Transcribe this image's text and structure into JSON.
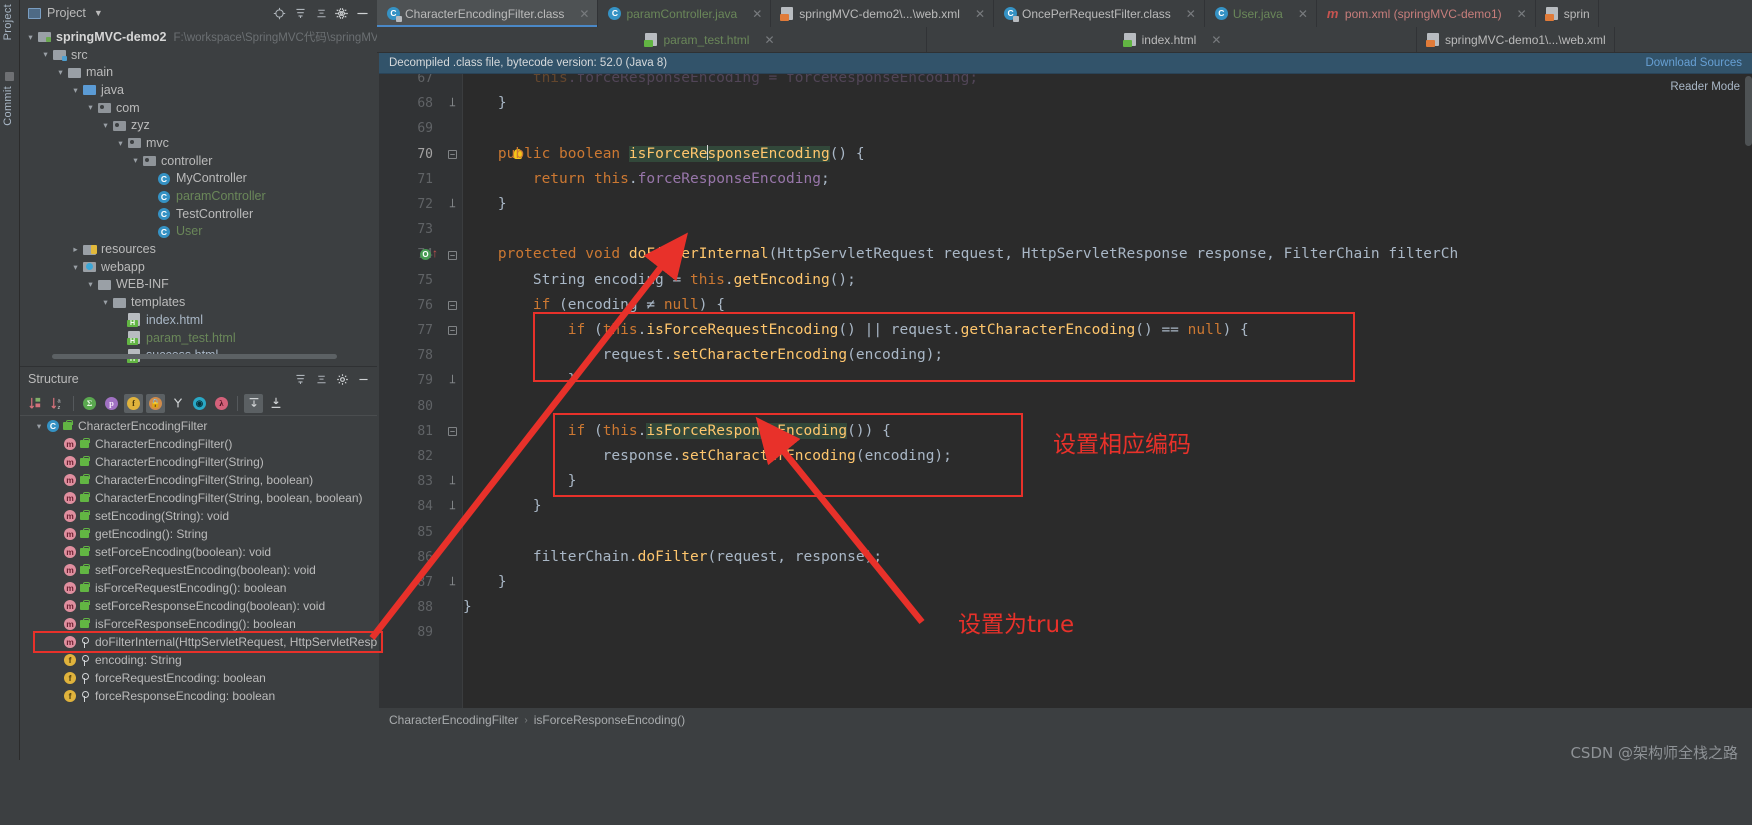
{
  "rail": {
    "project_label": "Project",
    "commit_label": "Commit"
  },
  "project_panel": {
    "title": "Project",
    "icons": [
      "locate-icon",
      "expand-all-icon",
      "collapse-all-icon",
      "gear-icon",
      "minimize-icon"
    ],
    "tree": [
      {
        "label": "springMVC-demo2",
        "path": "F:\\workspace\\SpringMVC代码\\springMVC",
        "depth": 0,
        "arrow": "open",
        "icon": "module-icon",
        "style": "bold"
      },
      {
        "label": "src",
        "depth": 1,
        "arrow": "open",
        "icon": "folder-src-icon",
        "style": "normal"
      },
      {
        "label": "main",
        "depth": 2,
        "arrow": "open",
        "icon": "folder-icon",
        "style": "normal"
      },
      {
        "label": "java",
        "depth": 3,
        "arrow": "open",
        "icon": "folder-source-icon",
        "style": "normal"
      },
      {
        "label": "com",
        "depth": 4,
        "arrow": "open",
        "icon": "package-icon",
        "style": "normal"
      },
      {
        "label": "zyz",
        "depth": 5,
        "arrow": "open",
        "icon": "package-icon",
        "style": "normal"
      },
      {
        "label": "mvc",
        "depth": 6,
        "arrow": "open",
        "icon": "package-icon",
        "style": "normal"
      },
      {
        "label": "controller",
        "depth": 7,
        "arrow": "open",
        "icon": "package-icon",
        "style": "normal"
      },
      {
        "label": "MyController",
        "depth": 8,
        "arrow": "none",
        "icon": "class-icon",
        "style": "normal"
      },
      {
        "label": "paramController",
        "depth": 8,
        "arrow": "none",
        "icon": "class-icon",
        "style": "green"
      },
      {
        "label": "TestController",
        "depth": 8,
        "arrow": "none",
        "icon": "class-icon",
        "style": "normal"
      },
      {
        "label": "User",
        "depth": 8,
        "arrow": "none",
        "icon": "class-icon",
        "style": "green"
      },
      {
        "label": "resources",
        "depth": 3,
        "arrow": "closed",
        "icon": "folder-resources-icon",
        "style": "normal"
      },
      {
        "label": "webapp",
        "depth": 3,
        "arrow": "open",
        "icon": "folder-web-icon",
        "style": "normal"
      },
      {
        "label": "WEB-INF",
        "depth": 4,
        "arrow": "open",
        "icon": "folder-icon",
        "style": "normal"
      },
      {
        "label": "templates",
        "depth": 5,
        "arrow": "open",
        "icon": "folder-icon",
        "style": "normal"
      },
      {
        "label": "index.html",
        "depth": 6,
        "arrow": "none",
        "icon": "html-file-icon",
        "style": "file"
      },
      {
        "label": "param_test.html",
        "depth": 6,
        "arrow": "none",
        "icon": "html-file-icon",
        "style": "filegreen"
      },
      {
        "label": "success.html",
        "depth": 6,
        "arrow": "none",
        "icon": "html-file-icon",
        "style": "file"
      }
    ]
  },
  "structure_panel": {
    "title": "Structure",
    "header_icons": [
      "expand-all-icon",
      "collapse-all-icon",
      "gear-icon",
      "minimize-icon"
    ],
    "toolbar_icons": [
      "sort-by-visibility-icon",
      "sort-alphabetically-icon",
      "show-inherited-icon",
      "show-properties-icon",
      "show-fields-icon",
      "show-non-public-icon",
      "show-anonymous-icon",
      "show-interfaces-icon",
      "show-lambdas-icon",
      "expand-all-icon",
      "collapse-all-icon"
    ],
    "items": [
      {
        "label": "CharacterEncodingFilter",
        "kind": "class",
        "vis": "class",
        "arrow": "open",
        "depth": 0
      },
      {
        "label": "CharacterEncodingFilter()",
        "kind": "method",
        "vis": "public",
        "arrow": "none",
        "depth": 1
      },
      {
        "label": "CharacterEncodingFilter(String)",
        "kind": "method",
        "vis": "public",
        "arrow": "none",
        "depth": 1
      },
      {
        "label": "CharacterEncodingFilter(String, boolean)",
        "kind": "method",
        "vis": "public",
        "arrow": "none",
        "depth": 1
      },
      {
        "label": "CharacterEncodingFilter(String, boolean, boolean)",
        "kind": "method",
        "vis": "public",
        "arrow": "none",
        "depth": 1
      },
      {
        "label": "setEncoding(String): void",
        "kind": "method",
        "vis": "public",
        "arrow": "none",
        "depth": 1
      },
      {
        "label": "getEncoding(): String",
        "kind": "method",
        "vis": "public",
        "arrow": "none",
        "depth": 1
      },
      {
        "label": "setForceEncoding(boolean): void",
        "kind": "method",
        "vis": "public",
        "arrow": "none",
        "depth": 1
      },
      {
        "label": "setForceRequestEncoding(boolean): void",
        "kind": "method",
        "vis": "public",
        "arrow": "none",
        "depth": 1
      },
      {
        "label": "isForceRequestEncoding(): boolean",
        "kind": "method",
        "vis": "public",
        "arrow": "none",
        "depth": 1
      },
      {
        "label": "setForceResponseEncoding(boolean): void",
        "kind": "method",
        "vis": "public",
        "arrow": "none",
        "depth": 1
      },
      {
        "label": "isForceResponseEncoding(): boolean",
        "kind": "method",
        "vis": "public",
        "arrow": "none",
        "depth": 1
      },
      {
        "label": "doFilterInternal(HttpServletRequest, HttpServletResponse",
        "kind": "method",
        "vis": "protected",
        "arrow": "none",
        "depth": 1,
        "highlighted": true
      },
      {
        "label": "encoding: String",
        "kind": "field",
        "vis": "private",
        "arrow": "none",
        "depth": 1
      },
      {
        "label": "forceRequestEncoding: boolean",
        "kind": "field",
        "vis": "private",
        "arrow": "none",
        "depth": 1
      },
      {
        "label": "forceResponseEncoding: boolean",
        "kind": "field",
        "vis": "private",
        "arrow": "none",
        "depth": 1
      }
    ]
  },
  "editor_tabs_row1": [
    {
      "label": "CharacterEncodingFilter.class",
      "icon": "class-file-icon",
      "active": true,
      "closable": true,
      "color": "normal"
    },
    {
      "label": "paramController.java",
      "icon": "class-icon",
      "active": false,
      "closable": true,
      "color": "green"
    },
    {
      "label": "springMVC-demo2\\...\\web.xml",
      "icon": "xml-file-icon",
      "active": false,
      "closable": true,
      "color": "normal"
    },
    {
      "label": "OncePerRequestFilter.class",
      "icon": "class-file-icon",
      "active": false,
      "closable": true,
      "color": "normal"
    },
    {
      "label": "User.java",
      "icon": "class-icon",
      "active": false,
      "closable": true,
      "color": "green"
    },
    {
      "label": "pom.xml (springMVC-demo1)",
      "icon": "maven-icon",
      "active": false,
      "closable": true,
      "color": "red"
    },
    {
      "label": "sprin",
      "icon": "xml-file-icon",
      "active": false,
      "closable": false,
      "color": "normal"
    }
  ],
  "editor_tabs_row2": [
    {
      "label": "param_test.html",
      "icon": "html-file-icon",
      "active": false,
      "closable": true,
      "color": "green"
    },
    {
      "label": "index.html",
      "icon": "html-file-icon",
      "active": false,
      "closable": true,
      "color": "normal"
    },
    {
      "label": "springMVC-demo1\\...\\web.xml",
      "icon": "xml-file-icon",
      "active": false,
      "closable": false,
      "color": "normal"
    }
  ],
  "banner": {
    "message": "Decompiled .class file, bytecode version: 52.0 (Java 8)",
    "download_sources": "Download Sources"
  },
  "reader_mode": "Reader Mode",
  "code": {
    "first_line_number": 67,
    "lines": [
      {
        "n": 67,
        "tokens": [
          {
            "t": "        ",
            "c": "pln"
          },
          {
            "t": "this",
            "c": "kw"
          },
          {
            "t": ".forceResponseEncoding = forceResponseEncoding;",
            "c": "fld"
          }
        ],
        "clipped": true
      },
      {
        "n": 68,
        "tokens": [
          {
            "t": "    }",
            "c": "pln"
          }
        ],
        "fold": "end"
      },
      {
        "n": 69,
        "tokens": []
      },
      {
        "n": 70,
        "tokens": [
          {
            "t": "    ",
            "c": "pln"
          },
          {
            "t": "public",
            "c": "kw"
          },
          {
            "t": " ",
            "c": "pln"
          },
          {
            "t": "boolean",
            "c": "kw"
          },
          {
            "t": " ",
            "c": "pln"
          },
          {
            "t": "isForceResponseEncoding",
            "c": "mth hl"
          },
          {
            "t": "() {",
            "c": "pln"
          }
        ],
        "fold": "start",
        "bulb": true,
        "caret_after": "isForceRe"
      },
      {
        "n": 71,
        "tokens": [
          {
            "t": "        ",
            "c": "pln"
          },
          {
            "t": "return",
            "c": "kw"
          },
          {
            "t": " ",
            "c": "pln"
          },
          {
            "t": "this",
            "c": "kw"
          },
          {
            "t": ".",
            "c": "pln"
          },
          {
            "t": "forceResponseEncoding",
            "c": "fld"
          },
          {
            "t": ";",
            "c": "pln"
          }
        ]
      },
      {
        "n": 72,
        "tokens": [
          {
            "t": "    }",
            "c": "pln"
          }
        ],
        "fold": "end"
      },
      {
        "n": 73,
        "tokens": []
      },
      {
        "n": 74,
        "tokens": [
          {
            "t": "    ",
            "c": "pln"
          },
          {
            "t": "protected",
            "c": "kw"
          },
          {
            "t": " ",
            "c": "pln"
          },
          {
            "t": "void",
            "c": "kw"
          },
          {
            "t": " ",
            "c": "pln"
          },
          {
            "t": "doFilterInternal",
            "c": "mth"
          },
          {
            "t": "(HttpServletRequest request, HttpServletResponse response, FilterChain filterCh",
            "c": "pln"
          }
        ],
        "fold": "start",
        "runmark": true
      },
      {
        "n": 75,
        "tokens": [
          {
            "t": "        String encoding = ",
            "c": "pln"
          },
          {
            "t": "this",
            "c": "kw"
          },
          {
            "t": ".",
            "c": "pln"
          },
          {
            "t": "getEncoding",
            "c": "mth"
          },
          {
            "t": "();",
            "c": "pln"
          }
        ]
      },
      {
        "n": 76,
        "tokens": [
          {
            "t": "        ",
            "c": "pln"
          },
          {
            "t": "if",
            "c": "kw"
          },
          {
            "t": " (encoding ≠ ",
            "c": "pln"
          },
          {
            "t": "null",
            "c": "kw"
          },
          {
            "t": ") {",
            "c": "pln"
          }
        ],
        "fold": "start"
      },
      {
        "n": 77,
        "tokens": [
          {
            "t": "            ",
            "c": "pln"
          },
          {
            "t": "if",
            "c": "kw"
          },
          {
            "t": " (",
            "c": "pln"
          },
          {
            "t": "this",
            "c": "kw"
          },
          {
            "t": ".",
            "c": "pln"
          },
          {
            "t": "isForceRequestEncoding",
            "c": "mth"
          },
          {
            "t": "() || request.",
            "c": "pln"
          },
          {
            "t": "getCharacterEncoding",
            "c": "mth"
          },
          {
            "t": "() == ",
            "c": "pln"
          },
          {
            "t": "null",
            "c": "kw"
          },
          {
            "t": ") {",
            "c": "pln"
          }
        ],
        "fold": "start"
      },
      {
        "n": 78,
        "tokens": [
          {
            "t": "                request.",
            "c": "pln"
          },
          {
            "t": "setCharacterEncoding",
            "c": "mth"
          },
          {
            "t": "(encoding);",
            "c": "pln"
          }
        ]
      },
      {
        "n": 79,
        "tokens": [
          {
            "t": "            }",
            "c": "pln"
          }
        ],
        "fold": "end"
      },
      {
        "n": 80,
        "tokens": []
      },
      {
        "n": 81,
        "tokens": [
          {
            "t": "            ",
            "c": "pln"
          },
          {
            "t": "if",
            "c": "kw"
          },
          {
            "t": " (",
            "c": "pln"
          },
          {
            "t": "this",
            "c": "kw"
          },
          {
            "t": ".",
            "c": "pln"
          },
          {
            "t": "isForceResponseEncoding",
            "c": "mth hl"
          },
          {
            "t": "()) {",
            "c": "pln"
          }
        ],
        "fold": "start"
      },
      {
        "n": 82,
        "tokens": [
          {
            "t": "                response.",
            "c": "pln"
          },
          {
            "t": "setCharacterEncoding",
            "c": "mth"
          },
          {
            "t": "(encoding);",
            "c": "pln"
          }
        ]
      },
      {
        "n": 83,
        "tokens": [
          {
            "t": "            }",
            "c": "pln"
          }
        ],
        "fold": "end"
      },
      {
        "n": 84,
        "tokens": [
          {
            "t": "        }",
            "c": "pln"
          }
        ],
        "fold": "end"
      },
      {
        "n": 85,
        "tokens": []
      },
      {
        "n": 86,
        "tokens": [
          {
            "t": "        filterChain.",
            "c": "pln"
          },
          {
            "t": "doFilter",
            "c": "mth"
          },
          {
            "t": "(request, response);",
            "c": "pln"
          }
        ]
      },
      {
        "n": 87,
        "tokens": [
          {
            "t": "    }",
            "c": "pln"
          }
        ],
        "fold": "end"
      },
      {
        "n": 88,
        "tokens": [
          {
            "t": "}",
            "c": "pln"
          }
        ]
      },
      {
        "n": 89,
        "tokens": []
      }
    ]
  },
  "annotations": {
    "note_set_encoding": "设置相应编码",
    "note_set_true": "设置为true",
    "accent_color": "#e8312a"
  },
  "breadcrumb": {
    "class": "CharacterEncodingFilter",
    "member": "isForceResponseEncoding()"
  },
  "watermark": "CSDN @架构师全栈之路"
}
